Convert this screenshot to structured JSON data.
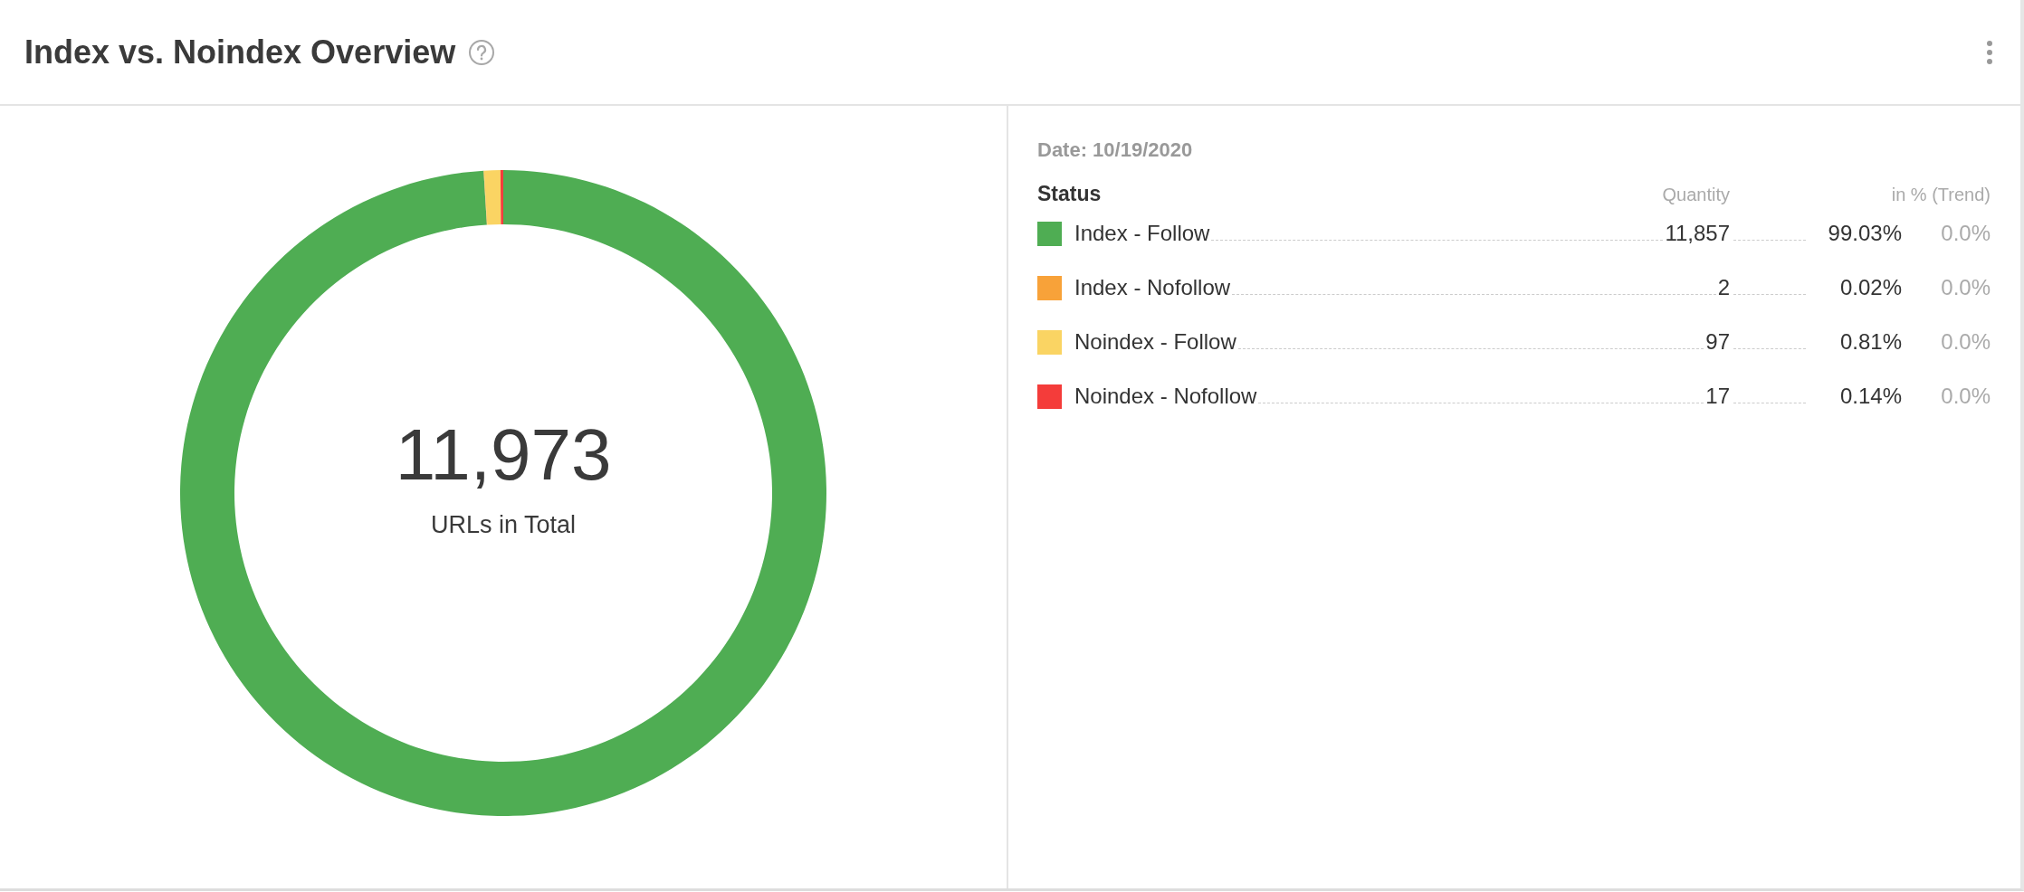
{
  "header": {
    "title": "Index vs. Noindex Overview"
  },
  "chart": {
    "center_value": "11,973",
    "center_label": "URLs in Total",
    "chart_data": {
      "type": "donut",
      "categories": [
        "Index - Follow",
        "Index - Nofollow",
        "Noindex - Follow",
        "Noindex - Nofollow"
      ],
      "series": [
        {
          "values": [
            99.03,
            0.02,
            0.81,
            0.14
          ]
        }
      ]
    }
  },
  "legend": {
    "date": "Date: 10/19/2020",
    "columns": [
      "Status",
      "Quantity",
      "in % (Trend)"
    ],
    "rows": [
      {
        "color": "#4fad53",
        "quantity": "11,857",
        "percent": "99.03%",
        "trend": "0.0%"
      },
      {
        "color": "#f8a239",
        "quantity": "2",
        "percent": "0.02%",
        "trend": "0.0%"
      },
      {
        "color": "#fad463",
        "quantity": "97",
        "percent": "0.81%",
        "trend": "0.0%"
      },
      {
        "color": "#f43c3a",
        "quantity": "17",
        "percent": "0.14%",
        "trend": "0.0%"
      }
    ]
  }
}
